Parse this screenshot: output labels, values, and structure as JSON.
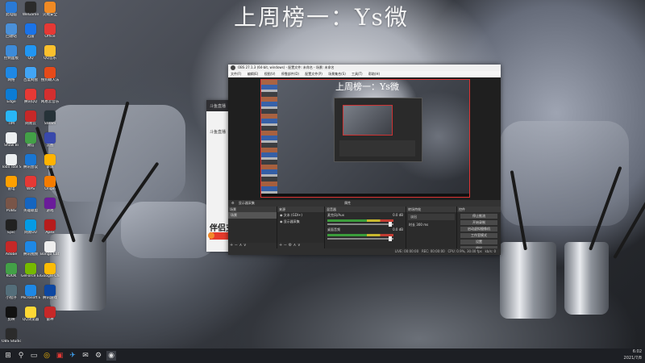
{
  "overlay_title": "上周榜一：Ys微",
  "desktop_icons": [
    {
      "label": "此电脑",
      "color": "#2a7ad6"
    },
    {
      "label": "WeGame",
      "color": "#2b2b2b"
    },
    {
      "label": "火绒安全",
      "color": "#f08a24"
    },
    {
      "label": "回收站",
      "color": "#4a90d9"
    },
    {
      "label": "迅雷",
      "color": "#1a73e8"
    },
    {
      "label": "Office",
      "color": "#e53935"
    },
    {
      "label": "控制面板",
      "color": "#3d8bd9"
    },
    {
      "label": "QQ",
      "color": "#2196f3"
    },
    {
      "label": "QQ音乐",
      "color": "#fbc02d"
    },
    {
      "label": "网络",
      "color": "#1e88e5"
    },
    {
      "label": "百度网盘",
      "color": "#42a5f5"
    },
    {
      "label": "搜狗输入法",
      "color": "#e64a19"
    },
    {
      "label": "Edge",
      "color": "#0c7cd5"
    },
    {
      "label": "腾讯QQ",
      "color": "#e53935"
    },
    {
      "label": "网易云音乐",
      "color": "#d32f2f"
    },
    {
      "label": "TIM",
      "color": "#29b6f6"
    },
    {
      "label": "网易云",
      "color": "#c62828"
    },
    {
      "label": "Steam",
      "color": "#263238"
    },
    {
      "label": "Show Bi",
      "color": "#eceff1"
    },
    {
      "label": "微信",
      "color": "#43a047"
    },
    {
      "label": "云图",
      "color": "#3949ab"
    },
    {
      "label": "Tobii Tool Screen",
      "color": "#eceff1"
    },
    {
      "label": "腾讯会议",
      "color": "#1976d2"
    },
    {
      "label": "录屏",
      "color": "#ffb300"
    },
    {
      "label": "雷电",
      "color": "#ffa000"
    },
    {
      "label": "WPS",
      "color": "#e53935"
    },
    {
      "label": "Origin",
      "color": "#f57c00"
    },
    {
      "label": "PUBG",
      "color": "#795548"
    },
    {
      "label": "英雄联盟",
      "color": "#1565c0"
    },
    {
      "label": "游戏",
      "color": "#6a1b9a"
    },
    {
      "label": "Epic",
      "color": "#212121"
    },
    {
      "label": "网易UU",
      "color": "#039be5"
    },
    {
      "label": "Apex",
      "color": "#b71c1c"
    },
    {
      "label": "Adobe",
      "color": "#c62828"
    },
    {
      "label": "腾讯视频",
      "color": "#1e88e5"
    },
    {
      "label": "Bongo Cat Mver",
      "color": "#eeeeee"
    },
    {
      "label": "KOOK",
      "color": "#43a047"
    },
    {
      "label": "GeForce Experience",
      "color": "#76b900"
    },
    {
      "label": "Google Chrome",
      "color": "#fbbc05"
    },
    {
      "label": "小程序",
      "color": "#546e7a"
    },
    {
      "label": "Microsoft Edge",
      "color": "#1e88e5"
    },
    {
      "label": "腾讯游戏",
      "color": "#0d47a1"
    },
    {
      "label": "剪映",
      "color": "#111111"
    },
    {
      "label": "QQ浏览器",
      "color": "#fdd835"
    },
    {
      "label": "雷神",
      "color": "#c62828"
    },
    {
      "label": "OBS Studio",
      "color": "#2b2b2b"
    }
  ],
  "browser": {
    "tab_title": "斗鱼直播",
    "header_text": "斗鱼直播",
    "big_text": "伴侣支持"
  },
  "obs": {
    "window_title": "OBS 27.1.3 (64-bit, windows) - 配置文件: 未命名 - 场景: 未命名",
    "menu": [
      "文件(F)",
      "编辑(E)",
      "视图(V)",
      "停靠部件(D)",
      "配置文件(P)",
      "场景集合(S)",
      "工具(T)",
      "帮助(H)"
    ],
    "preview_title": "上周榜一：Ys微",
    "scene_bar_text": "显示器采集",
    "scene_bar_right": "属性",
    "scenes": {
      "header": "场景",
      "items": [
        "场景"
      ]
    },
    "sources": {
      "header": "来源",
      "items": [
        "文本 (GDI+)",
        "显示器采集"
      ]
    },
    "mixer": {
      "header": "混音器",
      "channels": [
        {
          "name": "麦克风/Aux",
          "level": "0.0 dB"
        },
        {
          "name": "桌面音频",
          "level": "0.0 dB"
        }
      ]
    },
    "transitions": {
      "header": "转场特效",
      "type": "淡出",
      "duration_label": "时长",
      "duration": "300 ms"
    },
    "controls": {
      "header": "控件",
      "buttons": [
        "停止推流",
        "开始录制",
        "启动虚拟摄像机",
        "工作室模式",
        "设置",
        "退出"
      ]
    },
    "status": {
      "live": "LIVE: 00:00:00",
      "rec": "REC: 00:00:00",
      "cpu": "CPU: 0.9%, 30.00 fps",
      "kbps": "kb/s: 0"
    }
  },
  "taskbar": {
    "pinned": [
      "⊞",
      "⚲",
      "▭",
      "◎",
      "▣",
      "✈",
      "✉",
      "⚙",
      "◉"
    ],
    "time": "6:02",
    "date": "2021/7/8"
  }
}
